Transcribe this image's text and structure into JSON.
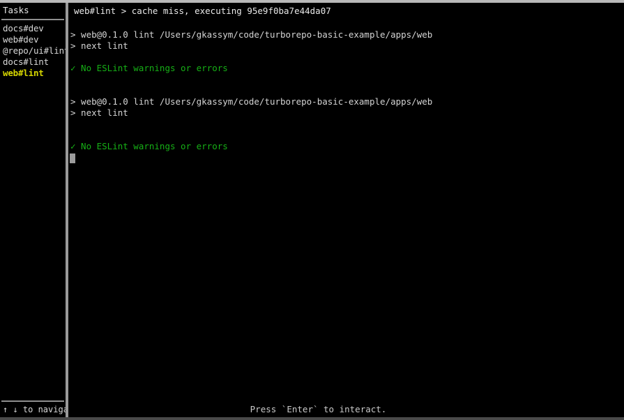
{
  "sidebar": {
    "title": "Tasks",
    "items": [
      {
        "label": "docs#dev",
        "selected": false
      },
      {
        "label": "web#dev",
        "selected": false
      },
      {
        "label": "@repo/ui#lint",
        "selected": false
      },
      {
        "label": "docs#lint",
        "selected": false
      },
      {
        "label": "web#lint",
        "selected": true
      }
    ],
    "footer_hint": "↑ ↓ to navigat"
  },
  "main": {
    "header": "web#lint > cache miss, executing 95e9f0ba7e44da07",
    "log_lines": [
      {
        "text": "",
        "type": "blank"
      },
      {
        "text": "> web@0.1.0 lint /Users/gkassym/code/turborepo-basic-example/apps/web",
        "type": "normal"
      },
      {
        "text": "> next lint",
        "type": "normal"
      },
      {
        "text": "",
        "type": "blank"
      },
      {
        "text": "✓ No ESLint warnings or errors",
        "type": "success"
      },
      {
        "text": "",
        "type": "blank"
      },
      {
        "text": "",
        "type": "blank"
      },
      {
        "text": "> web@0.1.0 lint /Users/gkassym/code/turborepo-basic-example/apps/web",
        "type": "normal"
      },
      {
        "text": "> next lint",
        "type": "normal"
      },
      {
        "text": "",
        "type": "blank"
      },
      {
        "text": "",
        "type": "blank"
      },
      {
        "text": "✓ No ESLint warnings or errors",
        "type": "success"
      }
    ],
    "footer_hint": "Press `Enter` to interact."
  },
  "colors": {
    "background": "#000000",
    "foreground": "#d4d4d4",
    "success_green": "#16b016",
    "selected_yellow": "#d7d700",
    "border_gray": "#9a9a9a",
    "cursor_gray": "#9c9c9c"
  }
}
